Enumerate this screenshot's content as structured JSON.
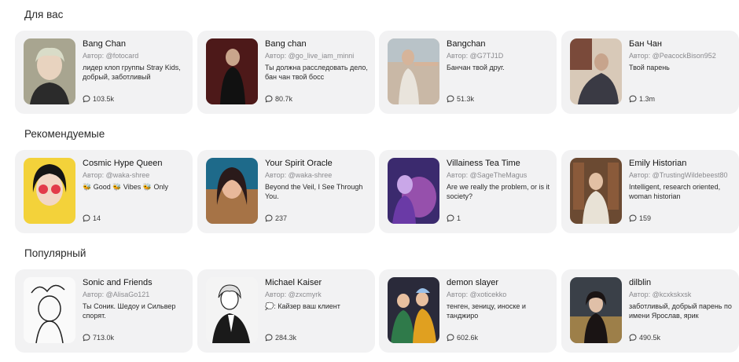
{
  "sections": [
    {
      "title": "Для вас",
      "cards": [
        {
          "name": "Bang Chan",
          "author": "Автор: @fotocard",
          "description": "лидер клоп группы Stray Kids, добрый, заботливый",
          "count": "103.5k"
        },
        {
          "name": "Bang chan",
          "author": "Автор: @go_live_iam_minni",
          "description": "Ты должна расследовать дело, бан чан твой босс",
          "count": "80.7k"
        },
        {
          "name": "Bangchan",
          "author": "Автор: @G7TJ1D",
          "description": "Банчан твой друг.",
          "count": "51.3k"
        },
        {
          "name": "Бан Чан",
          "author": "Автор: @PeacockBison952",
          "description": "Твой парень",
          "count": "1.3m"
        }
      ]
    },
    {
      "title": "Рекомендуемые",
      "cards": [
        {
          "name": "Cosmic Hype Queen",
          "author": "Автор: @waka-shree",
          "description": "🐝 Good 🐝 Vibes 🐝 Only",
          "count": "14"
        },
        {
          "name": "Your Spirit Oracle",
          "author": "Автор: @waka-shree",
          "description": "Beyond the Veil, I See Through You.",
          "count": "237"
        },
        {
          "name": "Villainess Tea Time",
          "author": "Автор: @SageTheMagus",
          "description": "Are we really the problem, or is it society?",
          "count": "1"
        },
        {
          "name": "Emily Historian",
          "author": "Автор: @TrustingWildebeest80",
          "description": "Intelligent, research oriented, woman historian",
          "count": "159"
        }
      ]
    },
    {
      "title": "Популярный",
      "cards": [
        {
          "name": "Sonic and Friends",
          "author": "Автор: @AlisaGo121",
          "description": "Ты Соник. Шедоу и Сильвер спорят.",
          "count": "713.0k"
        },
        {
          "name": "Michael Kaiser",
          "author": "Автор: @zxcmyrk",
          "description": "💭: Кайзер ваш клиент",
          "count": "284.3k"
        },
        {
          "name": "demon slayer",
          "author": "Автор: @xoticekko",
          "description": "тенген, зеницу, иноске и танджиро",
          "count": "602.6k"
        },
        {
          "name": "dilblin",
          "author": "Автор: @kcxkskxsk",
          "description": "заботливый, добрый парень по имени Ярослав, ярик",
          "count": "490.5k"
        }
      ]
    }
  ]
}
